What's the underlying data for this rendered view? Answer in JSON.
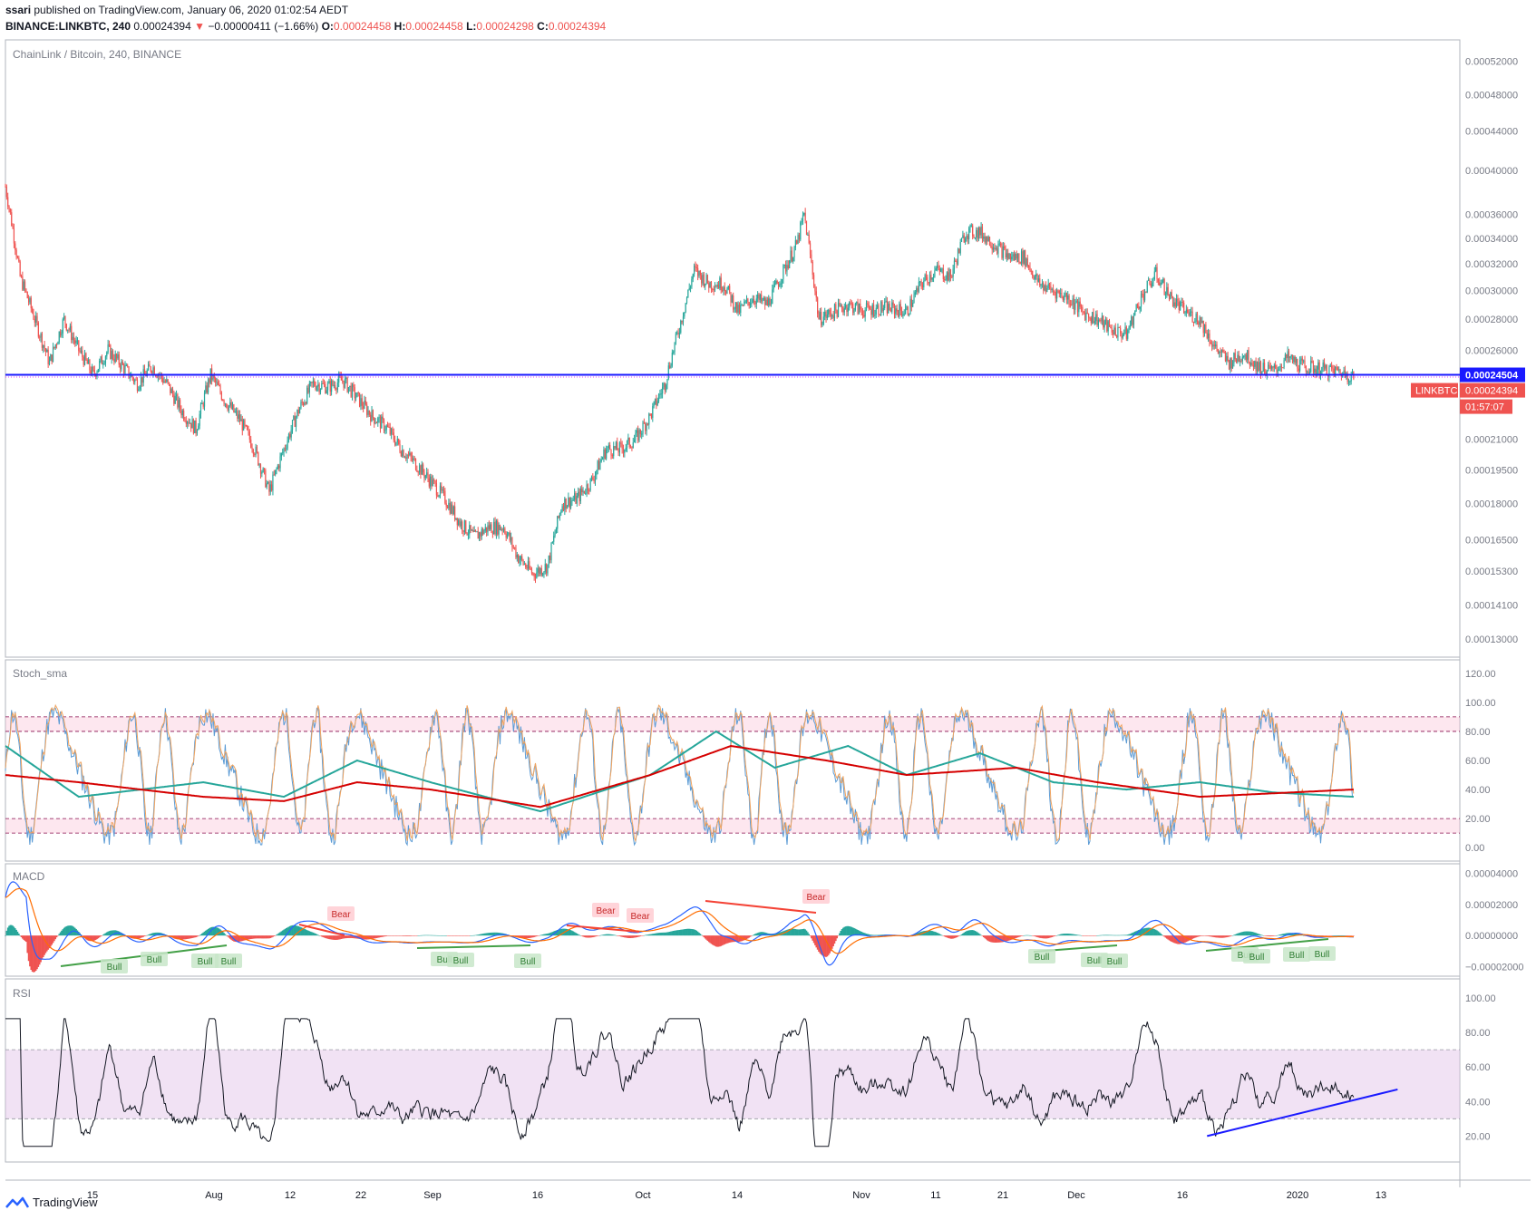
{
  "header": {
    "publisher": "ssari",
    "published_text": "published on TradingView.com, January 06, 2020 01:02:54 AEDT",
    "symbol_line": "BINANCE:LINKBTC, 240",
    "last": "0.00024394",
    "change": "−0.00000411 (−1.66%)",
    "o_label": "O:",
    "o": "0.00024458",
    "h_label": "H:",
    "h": "0.00024458",
    "l_label": "L:",
    "l": "0.00024298",
    "c_label": "C:",
    "c": "0.00024394"
  },
  "footer": {
    "brand": "TradingView"
  },
  "colors": {
    "up": "#26a69a",
    "down": "#ef5350",
    "hline": "#1a1aff",
    "stoch_k": "#5b9bd5",
    "stoch_d": "#f0a35e",
    "stoch_sma1": "#26a69a",
    "stoch_sma2": "#d50000",
    "macd": "#2962ff",
    "signal": "#ff6d00",
    "band": "#e1bee7",
    "bull": "#43a047",
    "bear": "#f44336"
  },
  "chart_data": [
    {
      "type": "candlestick",
      "pane": "price",
      "title": "ChainLink / Bitcoin, 240, BINANCE",
      "y_ticks": [
        "0.00052000",
        "0.00048000",
        "0.00044000",
        "0.00040000",
        "0.00036000",
        "0.00034000",
        "0.00032000",
        "0.00030000",
        "0.00028000",
        "0.00026000",
        "0.00021000",
        "0.00019500",
        "0.00018000",
        "0.00016500",
        "0.00015300",
        "0.00014100",
        "0.00013000"
      ],
      "ylim": [
        0.000125,
        0.000545
      ],
      "log_scale": true,
      "x_ticks": [
        "15",
        "Aug",
        "12",
        "22",
        "Sep",
        "16",
        "Oct",
        "14",
        "Nov",
        "11",
        "21",
        "Dec",
        "16",
        "2020",
        "13"
      ],
      "x_range": [
        "2019-07-05",
        "2020-01-19"
      ],
      "x_tick_dates": [
        "2019-07-15",
        "2019-08-01",
        "2019-08-12",
        "2019-08-22",
        "2019-09-01",
        "2019-09-16",
        "2019-10-01",
        "2019-10-14",
        "2019-11-01",
        "2019-11-11",
        "2019-11-21",
        "2019-12-01",
        "2019-12-16",
        "2020-01-01",
        "2020-01-13"
      ],
      "close_path": [
        [
          "2019-07-05",
          0.000385
        ],
        [
          "2019-07-07",
          0.00031
        ],
        [
          "2019-07-09",
          0.00028
        ],
        [
          "2019-07-11",
          0.000252
        ],
        [
          "2019-07-13",
          0.00028
        ],
        [
          "2019-07-15",
          0.00026
        ],
        [
          "2019-07-17",
          0.000245
        ],
        [
          "2019-07-19",
          0.00026
        ],
        [
          "2019-07-21",
          0.00025
        ],
        [
          "2019-07-23",
          0.00024
        ],
        [
          "2019-07-25",
          0.00025
        ],
        [
          "2019-07-27",
          0.00024
        ],
        [
          "2019-07-29",
          0.000225
        ],
        [
          "2019-07-31",
          0.000215
        ],
        [
          "2019-08-02",
          0.000245
        ],
        [
          "2019-08-04",
          0.00023
        ],
        [
          "2019-08-06",
          0.00022
        ],
        [
          "2019-08-08",
          0.000205
        ],
        [
          "2019-08-10",
          0.000185
        ],
        [
          "2019-08-12",
          0.000205
        ],
        [
          "2019-08-14",
          0.000225
        ],
        [
          "2019-08-16",
          0.00024
        ],
        [
          "2019-08-18",
          0.000238
        ],
        [
          "2019-08-20",
          0.000242
        ],
        [
          "2019-08-22",
          0.000232
        ],
        [
          "2019-08-24",
          0.000222
        ],
        [
          "2019-08-26",
          0.000216
        ],
        [
          "2019-08-28",
          0.000205
        ],
        [
          "2019-08-30",
          0.000198
        ],
        [
          "2019-09-01",
          0.00019
        ],
        [
          "2019-09-03",
          0.000182
        ],
        [
          "2019-09-05",
          0.000172
        ],
        [
          "2019-09-07",
          0.000166
        ],
        [
          "2019-09-09",
          0.00017
        ],
        [
          "2019-09-11",
          0.00017
        ],
        [
          "2019-09-13",
          0.000158
        ],
        [
          "2019-09-15",
          0.000152
        ],
        [
          "2019-09-17",
          0.000155
        ],
        [
          "2019-09-19",
          0.00018
        ],
        [
          "2019-09-21",
          0.000182
        ],
        [
          "2019-09-23",
          0.00019
        ],
        [
          "2019-09-25",
          0.000205
        ],
        [
          "2019-09-27",
          0.000205
        ],
        [
          "2019-09-29",
          0.00021
        ],
        [
          "2019-10-01",
          0.000222
        ],
        [
          "2019-10-03",
          0.00024
        ],
        [
          "2019-10-05",
          0.000275
        ],
        [
          "2019-10-07",
          0.000315
        ],
        [
          "2019-10-09",
          0.000305
        ],
        [
          "2019-10-11",
          0.000305
        ],
        [
          "2019-10-13",
          0.000285
        ],
        [
          "2019-10-15",
          0.000295
        ],
        [
          "2019-10-17",
          0.00029
        ],
        [
          "2019-10-19",
          0.000312
        ],
        [
          "2019-10-21",
          0.000335
        ],
        [
          "2019-10-22",
          0.00036
        ],
        [
          "2019-10-24",
          0.00028
        ],
        [
          "2019-10-26",
          0.000285
        ],
        [
          "2019-10-28",
          0.00029
        ],
        [
          "2019-10-30",
          0.000286
        ],
        [
          "2019-11-02",
          0.000288
        ],
        [
          "2019-11-05",
          0.000285
        ],
        [
          "2019-11-07",
          0.000305
        ],
        [
          "2019-11-09",
          0.000315
        ],
        [
          "2019-11-11",
          0.00031
        ],
        [
          "2019-11-13",
          0.000345
        ],
        [
          "2019-11-15",
          0.000345
        ],
        [
          "2019-11-17",
          0.000335
        ],
        [
          "2019-11-19",
          0.000325
        ],
        [
          "2019-11-21",
          0.000325
        ],
        [
          "2019-11-23",
          0.000305
        ],
        [
          "2019-11-25",
          0.0003
        ],
        [
          "2019-11-27",
          0.000295
        ],
        [
          "2019-11-29",
          0.000285
        ],
        [
          "2019-12-01",
          0.00028
        ],
        [
          "2019-12-03",
          0.000273
        ],
        [
          "2019-12-05",
          0.00027
        ],
        [
          "2019-12-07",
          0.000295
        ],
        [
          "2019-12-09",
          0.000312
        ],
        [
          "2019-12-11",
          0.000295
        ],
        [
          "2019-12-13",
          0.000285
        ],
        [
          "2019-12-15",
          0.00028
        ],
        [
          "2019-12-17",
          0.000262
        ],
        [
          "2019-12-19",
          0.000252
        ],
        [
          "2019-12-21",
          0.000258
        ],
        [
          "2019-12-23",
          0.00025
        ],
        [
          "2019-12-25",
          0.000247
        ],
        [
          "2019-12-27",
          0.000255
        ],
        [
          "2019-12-29",
          0.00025
        ],
        [
          "2020-01-01",
          0.000248
        ],
        [
          "2020-01-03",
          0.000247
        ],
        [
          "2020-01-05",
          0.000244
        ]
      ],
      "hline": 0.00024504,
      "price_labels": [
        {
          "text": "0.00024504"
        },
        {
          "symbol": "LINKBTC",
          "text": "0.00024394"
        },
        {
          "text": "01:57:07"
        }
      ]
    },
    {
      "type": "line",
      "pane": "oscillator",
      "title": "Stoch_sma",
      "y_ticks": [
        "120.00",
        "100.00",
        "80.00",
        "60.00",
        "40.00",
        "20.00",
        "0.00"
      ],
      "ylim": [
        -8,
        128
      ],
      "bands": [
        [
          80,
          90
        ],
        [
          10,
          20
        ]
      ],
      "series": [
        {
          "key": "sma_fast",
          "path": [
            [
              "2019-07-05",
              70
            ],
            [
              "2019-07-15",
              35
            ],
            [
              "2019-08-01",
              45
            ],
            [
              "2019-08-12",
              35
            ],
            [
              "2019-08-22",
              60
            ],
            [
              "2019-09-01",
              45
            ],
            [
              "2019-09-16",
              25
            ],
            [
              "2019-10-01",
              50
            ],
            [
              "2019-10-10",
              80
            ],
            [
              "2019-10-18",
              55
            ],
            [
              "2019-10-28",
              70
            ],
            [
              "2019-11-05",
              50
            ],
            [
              "2019-11-15",
              65
            ],
            [
              "2019-11-25",
              45
            ],
            [
              "2019-12-05",
              40
            ],
            [
              "2019-12-15",
              45
            ],
            [
              "2019-12-25",
              38
            ],
            [
              "2020-01-05",
              35
            ]
          ]
        },
        {
          "key": "sma_slow",
          "path": [
            [
              "2019-07-05",
              50
            ],
            [
              "2019-07-15",
              45
            ],
            [
              "2019-08-01",
              35
            ],
            [
              "2019-08-12",
              32
            ],
            [
              "2019-08-22",
              45
            ],
            [
              "2019-09-01",
              40
            ],
            [
              "2019-09-16",
              28
            ],
            [
              "2019-10-01",
              50
            ],
            [
              "2019-10-12",
              70
            ],
            [
              "2019-10-25",
              60
            ],
            [
              "2019-11-05",
              50
            ],
            [
              "2019-11-20",
              55
            ],
            [
              "2019-12-01",
              45
            ],
            [
              "2019-12-15",
              35
            ],
            [
              "2020-01-05",
              40
            ]
          ]
        }
      ]
    },
    {
      "type": "line",
      "pane": "oscillator",
      "title": "MACD",
      "y_ticks": [
        "0.00004000",
        "0.00002000",
        "0.00000000",
        "−0.00002000"
      ],
      "ylim": [
        -2.5e-05,
        4.5e-05
      ],
      "divergence_labels": [
        {
          "text": "Bull"
        },
        {
          "text": "Bull"
        },
        {
          "text": "Bull"
        },
        {
          "text": "Bull"
        },
        {
          "text": "Bull"
        },
        {
          "text": "Bull"
        },
        {
          "text": "Bull"
        },
        {
          "text": "Bull"
        },
        {
          "text": "Bull"
        },
        {
          "text": "Bull"
        },
        {
          "text": "Bull"
        },
        {
          "text": "Bull"
        },
        {
          "text": "Bull"
        },
        {
          "text": "Bull"
        },
        {
          "text": "Bear"
        },
        {
          "text": "Bear"
        },
        {
          "text": "Bear"
        },
        {
          "text": "Bear"
        }
      ]
    },
    {
      "type": "line",
      "pane": "oscillator",
      "title": "RSI",
      "y_ticks": [
        "100.00",
        "80.00",
        "60.00",
        "40.00",
        "20.00"
      ],
      "ylim": [
        6,
        110
      ],
      "band": [
        30,
        70
      ],
      "trendline": [
        [
          "2019-12-16",
          20
        ],
        [
          "2020-01-11",
          47
        ]
      ]
    }
  ]
}
